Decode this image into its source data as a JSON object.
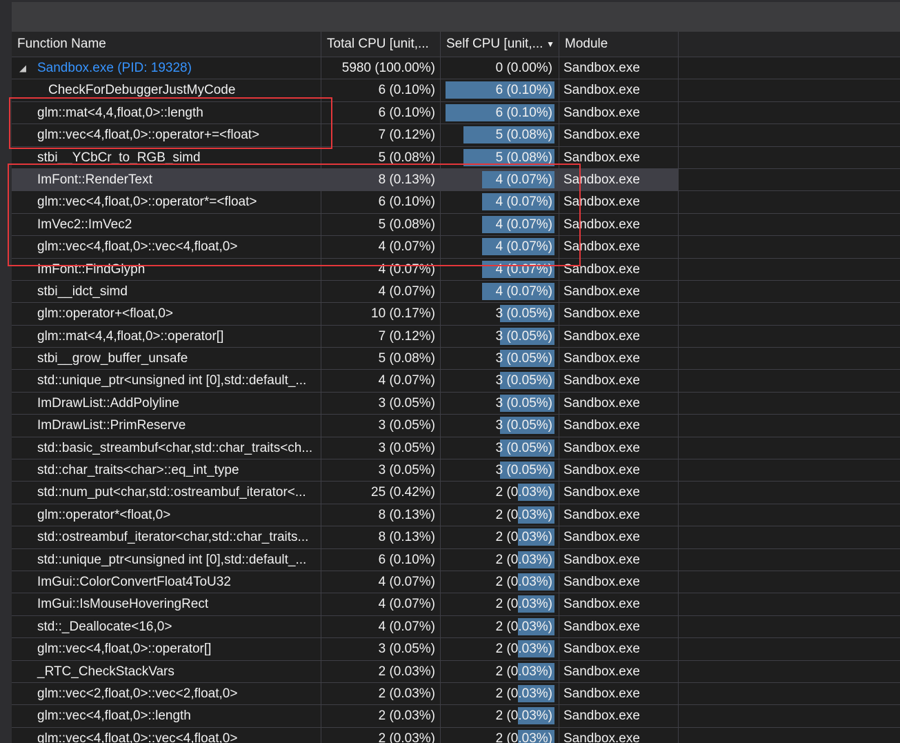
{
  "columns": {
    "function_name": "Function Name",
    "total_cpu": "Total CPU [unit,...",
    "self_cpu": "Self CPU [unit,...",
    "module": "Module"
  },
  "root": {
    "name": "Sandbox.exe (PID: 19328)",
    "total": "5980 (100.00%)",
    "self": "0 (0.00%)",
    "module": "Sandbox.exe"
  },
  "rows": [
    {
      "name": "CheckForDebuggerJustMyCode",
      "total": "6 (0.10%)",
      "self": "6 (0.10%)",
      "self_fraction": 1.0,
      "module": "Sandbox.exe"
    },
    {
      "name": "glm::mat<4,4,float,0>::length",
      "total": "6 (0.10%)",
      "self": "6 (0.10%)",
      "self_fraction": 1.0,
      "module": "Sandbox.exe"
    },
    {
      "name": "glm::vec<4,float,0>::operator+=<float>",
      "total": "7 (0.12%)",
      "self": "5 (0.08%)",
      "self_fraction": 0.833,
      "module": "Sandbox.exe"
    },
    {
      "name": "stbi__YCbCr_to_RGB_simd",
      "total": "5 (0.08%)",
      "self": "5 (0.08%)",
      "self_fraction": 0.833,
      "module": "Sandbox.exe"
    },
    {
      "name": "ImFont::RenderText",
      "total": "8 (0.13%)",
      "self": "4 (0.07%)",
      "self_fraction": 0.667,
      "module": "Sandbox.exe"
    },
    {
      "name": "glm::vec<4,float,0>::operator*=<float>",
      "total": "6 (0.10%)",
      "self": "4 (0.07%)",
      "self_fraction": 0.667,
      "module": "Sandbox.exe"
    },
    {
      "name": "ImVec2::ImVec2",
      "total": "5 (0.08%)",
      "self": "4 (0.07%)",
      "self_fraction": 0.667,
      "module": "Sandbox.exe"
    },
    {
      "name": "glm::vec<4,float,0>::vec<4,float,0>",
      "total": "4 (0.07%)",
      "self": "4 (0.07%)",
      "self_fraction": 0.667,
      "module": "Sandbox.exe"
    },
    {
      "name": "ImFont::FindGlyph",
      "total": "4 (0.07%)",
      "self": "4 (0.07%)",
      "self_fraction": 0.667,
      "module": "Sandbox.exe"
    },
    {
      "name": "stbi__idct_simd",
      "total": "4 (0.07%)",
      "self": "4 (0.07%)",
      "self_fraction": 0.667,
      "module": "Sandbox.exe"
    },
    {
      "name": "glm::operator+<float,0>",
      "total": "10 (0.17%)",
      "self": "3 (0.05%)",
      "self_fraction": 0.5,
      "module": "Sandbox.exe"
    },
    {
      "name": "glm::mat<4,4,float,0>::operator[]",
      "total": "7 (0.12%)",
      "self": "3 (0.05%)",
      "self_fraction": 0.5,
      "module": "Sandbox.exe"
    },
    {
      "name": "stbi__grow_buffer_unsafe",
      "total": "5 (0.08%)",
      "self": "3 (0.05%)",
      "self_fraction": 0.5,
      "module": "Sandbox.exe"
    },
    {
      "name": "std::unique_ptr<unsigned int [0],std::default_...",
      "total": "4 (0.07%)",
      "self": "3 (0.05%)",
      "self_fraction": 0.5,
      "module": "Sandbox.exe"
    },
    {
      "name": "ImDrawList::AddPolyline",
      "total": "3 (0.05%)",
      "self": "3 (0.05%)",
      "self_fraction": 0.5,
      "module": "Sandbox.exe"
    },
    {
      "name": "ImDrawList::PrimReserve",
      "total": "3 (0.05%)",
      "self": "3 (0.05%)",
      "self_fraction": 0.5,
      "module": "Sandbox.exe"
    },
    {
      "name": "std::basic_streambuf<char,std::char_traits<ch...",
      "total": "3 (0.05%)",
      "self": "3 (0.05%)",
      "self_fraction": 0.5,
      "module": "Sandbox.exe"
    },
    {
      "name": "std::char_traits<char>::eq_int_type",
      "total": "3 (0.05%)",
      "self": "3 (0.05%)",
      "self_fraction": 0.5,
      "module": "Sandbox.exe"
    },
    {
      "name": "std::num_put<char,std::ostreambuf_iterator<...",
      "total": "25 (0.42%)",
      "self": "2 (0.03%)",
      "self_fraction": 0.333,
      "module": "Sandbox.exe"
    },
    {
      "name": "glm::operator*<float,0>",
      "total": "8 (0.13%)",
      "self": "2 (0.03%)",
      "self_fraction": 0.333,
      "module": "Sandbox.exe"
    },
    {
      "name": "std::ostreambuf_iterator<char,std::char_traits...",
      "total": "8 (0.13%)",
      "self": "2 (0.03%)",
      "self_fraction": 0.333,
      "module": "Sandbox.exe"
    },
    {
      "name": "std::unique_ptr<unsigned int [0],std::default_...",
      "total": "6 (0.10%)",
      "self": "2 (0.03%)",
      "self_fraction": 0.333,
      "module": "Sandbox.exe"
    },
    {
      "name": "ImGui::ColorConvertFloat4ToU32",
      "total": "4 (0.07%)",
      "self": "2 (0.03%)",
      "self_fraction": 0.333,
      "module": "Sandbox.exe"
    },
    {
      "name": "ImGui::IsMouseHoveringRect",
      "total": "4 (0.07%)",
      "self": "2 (0.03%)",
      "self_fraction": 0.333,
      "module": "Sandbox.exe"
    },
    {
      "name": "std::_Deallocate<16,0>",
      "total": "4 (0.07%)",
      "self": "2 (0.03%)",
      "self_fraction": 0.333,
      "module": "Sandbox.exe"
    },
    {
      "name": "glm::vec<4,float,0>::operator[]",
      "total": "3 (0.05%)",
      "self": "2 (0.03%)",
      "self_fraction": 0.333,
      "module": "Sandbox.exe"
    },
    {
      "name": "_RTC_CheckStackVars",
      "total": "2 (0.03%)",
      "self": "2 (0.03%)",
      "self_fraction": 0.333,
      "module": "Sandbox.exe"
    },
    {
      "name": "glm::vec<2,float,0>::vec<2,float,0>",
      "total": "2 (0.03%)",
      "self": "2 (0.03%)",
      "self_fraction": 0.333,
      "module": "Sandbox.exe"
    },
    {
      "name": "glm::vec<4,float,0>::length",
      "total": "2 (0.03%)",
      "self": "2 (0.03%)",
      "self_fraction": 0.333,
      "module": "Sandbox.exe"
    },
    {
      "name": "glm::vec<4,float,0>::vec<4,float,0>",
      "total": "2 (0.03%)",
      "self": "2 (0.03%)",
      "self_fraction": 0.333,
      "module": "Sandbox.exe"
    }
  ],
  "selected_row": 4,
  "colors": {
    "bar": "#4a77a0",
    "link": "#3794ff",
    "annotation": "#e5373b"
  }
}
